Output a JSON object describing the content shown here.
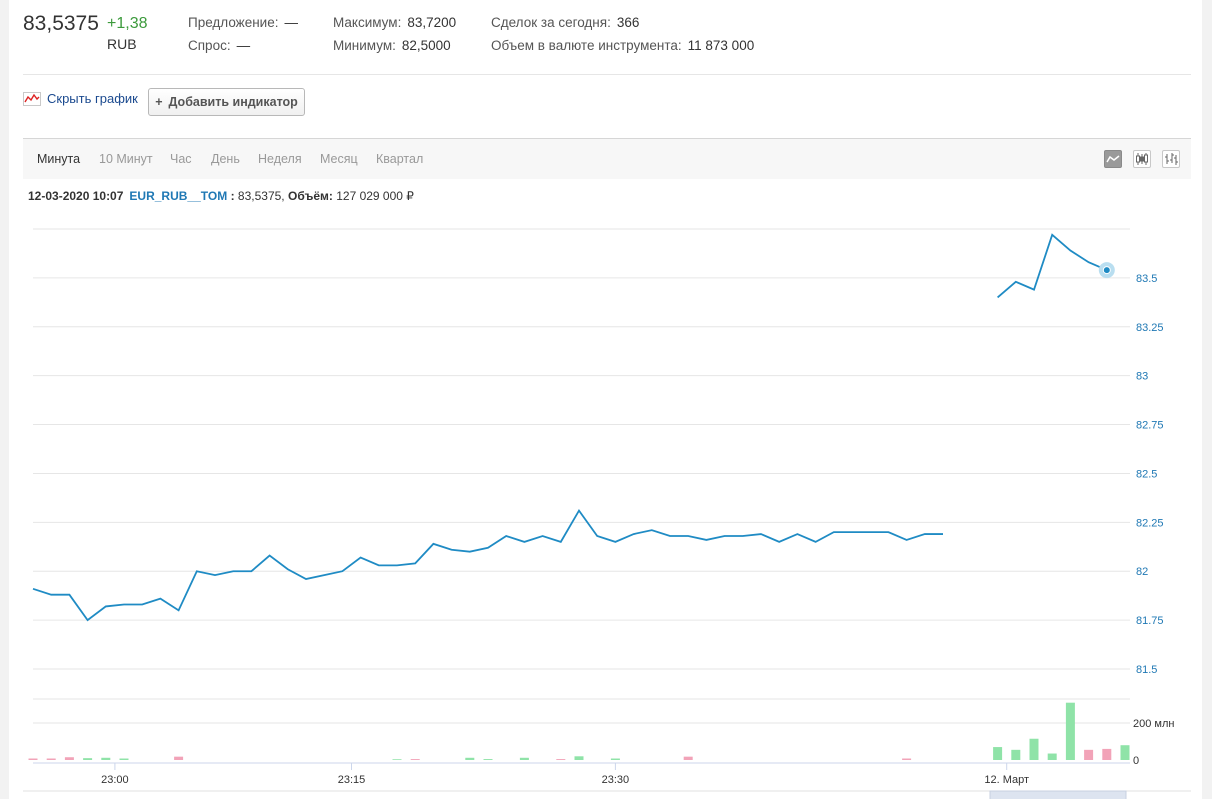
{
  "header": {
    "price": "83,5375",
    "change": "+1,38",
    "currency": "RUB",
    "offer_label": "Предложение:",
    "offer_value": "—",
    "bid_label": "Спрос:",
    "bid_value": "—",
    "max_label": "Максимум:",
    "max_value": "83,7200",
    "min_label": "Минимум:",
    "min_value": "82,5000",
    "deals_label": "Сделок за сегодня:",
    "deals_value": "366",
    "volume_label": "Объем в валюте инструмента:",
    "volume_value": "11 873 000"
  },
  "controls": {
    "hide_chart": "Скрыть график",
    "add_indicator": "Добавить индикатор"
  },
  "tabs": [
    {
      "label": "Минута",
      "active": true
    },
    {
      "label": "10 Минут",
      "active": false
    },
    {
      "label": "Час",
      "active": false
    },
    {
      "label": "День",
      "active": false
    },
    {
      "label": "Неделя",
      "active": false
    },
    {
      "label": "Месяц",
      "active": false
    },
    {
      "label": "Квартал",
      "active": false
    }
  ],
  "chart_types": [
    "line-chart-icon",
    "candlestick-icon",
    "ohlc-bars-icon"
  ],
  "info": {
    "datetime": "12-03-2020 10:07",
    "ticker": "EUR_RUB__TOM",
    "sep": ":",
    "price": "83,5375,",
    "volume_label": "Объём:",
    "volume_value": "127 029 000 ₽"
  },
  "colors": {
    "line": "#1f8bc4",
    "positive": "#3c9a3c",
    "volume_up": "#8fe3a8",
    "volume_down": "#f2a3b8",
    "ticker": "#1f78b4"
  },
  "chart_data": {
    "type": "line",
    "title": "",
    "xlabel": "",
    "ylabel": "",
    "ylim": [
      81.5,
      83.75
    ],
    "y_ticks": [
      81.5,
      81.75,
      82,
      82.25,
      82.5,
      82.75,
      83,
      83.25,
      83.5
    ],
    "y_tick_labels": [
      "81.5",
      "81.75",
      "82",
      "82.25",
      "82.5",
      "82.75",
      "83",
      "83.25",
      "83.5"
    ],
    "x_tick_labels": [
      "23:00",
      "23:15",
      "23:30",
      "12. Март"
    ],
    "series": [
      {
        "segment": "11 March",
        "x_min": [
          1,
          2,
          3,
          4,
          5,
          6,
          7,
          8,
          9,
          10,
          11,
          12,
          13,
          14,
          15,
          16,
          17,
          18,
          19,
          20,
          21,
          22,
          23,
          24,
          25,
          26,
          27,
          28,
          29,
          30,
          31,
          32,
          33,
          34,
          35,
          36,
          37,
          38,
          39,
          40,
          41,
          42,
          43,
          44,
          45,
          46,
          47,
          48,
          49,
          50,
          51
        ],
        "values": [
          81.91,
          81.88,
          81.88,
          81.75,
          81.82,
          81.83,
          81.83,
          81.86,
          81.8,
          82.0,
          81.98,
          82.0,
          82.0,
          82.08,
          82.01,
          81.96,
          81.98,
          82.0,
          82.07,
          82.03,
          82.03,
          82.04,
          82.14,
          82.11,
          82.1,
          82.12,
          82.18,
          82.15,
          82.18,
          82.15,
          82.31,
          82.18,
          82.15,
          82.19,
          82.21,
          82.18,
          82.18,
          82.16,
          82.18,
          82.18,
          82.19,
          82.15,
          82.19,
          82.15,
          82.2,
          82.2,
          82.2,
          82.2,
          82.16,
          82.19,
          82.19
        ]
      },
      {
        "segment": "12 March",
        "x_min": [
          1,
          2,
          3,
          4,
          5,
          6,
          7
        ],
        "values": [
          83.4,
          83.48,
          83.44,
          83.72,
          83.64,
          83.58,
          83.54
        ]
      }
    ],
    "volume": {
      "axis_labels": [
        "200 млн",
        "0"
      ],
      "ylim_mln": [
        0,
        330
      ],
      "bars": [
        {
          "x": 1,
          "v": 8,
          "dir": "down"
        },
        {
          "x": 2,
          "v": 8,
          "dir": "down"
        },
        {
          "x": 3,
          "v": 15,
          "dir": "down"
        },
        {
          "x": 4,
          "v": 10,
          "dir": "up"
        },
        {
          "x": 5,
          "v": 12,
          "dir": "up"
        },
        {
          "x": 6,
          "v": 8,
          "dir": "up"
        },
        {
          "x": 9,
          "v": 18,
          "dir": "down"
        },
        {
          "x": 21,
          "v": 4,
          "dir": "up"
        },
        {
          "x": 22,
          "v": 5,
          "dir": "down"
        },
        {
          "x": 25,
          "v": 12,
          "dir": "up"
        },
        {
          "x": 26,
          "v": 5,
          "dir": "up"
        },
        {
          "x": 28,
          "v": 12,
          "dir": "up"
        },
        {
          "x": 30,
          "v": 5,
          "dir": "down"
        },
        {
          "x": 31,
          "v": 20,
          "dir": "up"
        },
        {
          "x": 33,
          "v": 8,
          "dir": "up"
        },
        {
          "x": 37,
          "v": 18,
          "dir": "down"
        },
        {
          "x": 49,
          "v": 8,
          "dir": "down"
        },
        {
          "x": 54,
          "v": 70,
          "dir": "up"
        },
        {
          "x": 55,
          "v": 55,
          "dir": "up"
        },
        {
          "x": 56,
          "v": 115,
          "dir": "up"
        },
        {
          "x": 57,
          "v": 35,
          "dir": "up"
        },
        {
          "x": 58,
          "v": 310,
          "dir": "up"
        },
        {
          "x": 59,
          "v": 55,
          "dir": "down"
        },
        {
          "x": 60,
          "v": 60,
          "dir": "down"
        },
        {
          "x": 61,
          "v": 80,
          "dir": "up"
        }
      ]
    }
  }
}
